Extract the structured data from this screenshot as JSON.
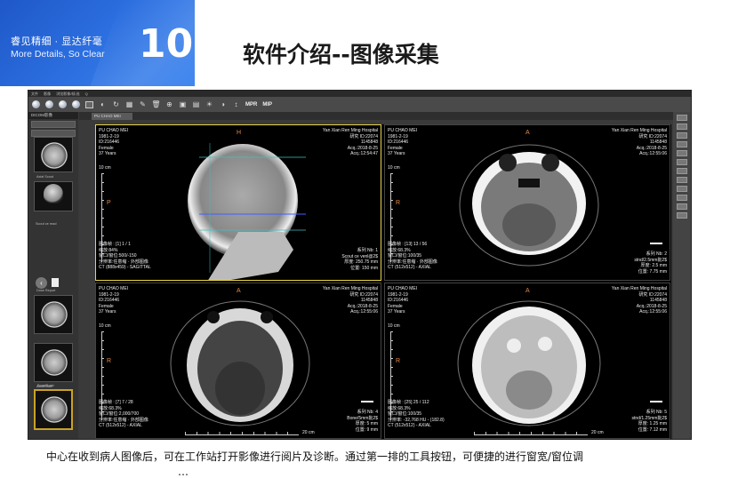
{
  "banner": {
    "slogan_cn": "睿见精细 · 显达纤毫",
    "slogan_en": "More Details, So Clear",
    "slide_number": "10"
  },
  "title": "软件介绍--图像采集",
  "app": {
    "menu": [
      "文件",
      "影像",
      "浏览影像/帧/选",
      "Q"
    ],
    "toolbar_text": [
      "MPR",
      "MIP"
    ],
    "sidebar": {
      "header": "DICOM影像",
      "series": [
        {
          "label": "Axial Scout"
        },
        {
          "label": "Scout ce read"
        },
        {
          "label": "Dose Report"
        },
        {
          "label": "Axial/Brain"
        },
        {
          "label": "Bone/Brain"
        },
        {
          "label": ""
        }
      ]
    },
    "tab": "PU CHAO MEI"
  },
  "panes": [
    {
      "patient": [
        "PU CHAO MEI",
        "1981-2-19",
        "ID:216446",
        "Female",
        "37 Years"
      ],
      "hospital": [
        "Yan Xian Ren Ming Hospital",
        "研究 ID:22074",
        "1145848",
        "Acq.:2018-8-25",
        "Acq.:12:54:47"
      ],
      "top_orient": "H",
      "left_orient": "P",
      "scale": "10 cm",
      "bottom_left": [
        "图像帧 : [1] 1 / 1",
        "缩放:84%",
        "窗口/窗位:500/-150",
        "分辨率:任意缩 · 外部图像",
        "CT (888x459) - SAGITTAL"
      ],
      "bottom_right": [
        "系列 Nb: 1",
        "Scout ce venl@2$",
        "厚度: 250.75 mm",
        "位置: 150 mm"
      ],
      "scale_label": "20 cm"
    },
    {
      "patient": [
        "PU CHAO MEI",
        "1981-2-19",
        "ID:216446",
        "Female",
        "37 Years"
      ],
      "hospital": [
        "Yan Xian Ren Ming Hospital",
        "研究 ID:22074",
        "1145848",
        "Acq.:2018-8-25",
        "Acq.:12:55:06"
      ],
      "top_orient": "A",
      "left_orient": "R",
      "scale": "10 cm",
      "bottom_left": [
        "图像帧 : [13] 13 / 56",
        "缩放:68.3%",
        "窗口/窗位:100/35",
        "分辨率:任意缩 · 外部图像",
        "CT (512x512) - AXIAL"
      ],
      "bottom_right": [
        "系列 Nb: 2",
        "stnd/2.5mm批2$",
        "厚度: 2.5 mm",
        "位置: 7.75 mm"
      ],
      "scale_label": "20 cm"
    },
    {
      "patient": [
        "PU CHAO MEI",
        "1981-2-19",
        "ID:216446",
        "Female",
        "37 Years"
      ],
      "hospital": [
        "Yan Xian Ren Ming Hospital",
        "研究 ID:22074",
        "1145848",
        "Acq.:2018-8-25",
        "Acq.:12:55:06"
      ],
      "top_orient": "A",
      "left_orient": "R",
      "scale": "10 cm",
      "bottom_left": [
        "图像帧 : [7] 7 / 28",
        "缩放:68.3%",
        "窗口/窗位:2,000/700",
        "分辨率:任意缩 · 外部图像",
        "CT (512x512) - AXIAL"
      ],
      "bottom_right": [
        "系列 Nb: 4",
        "Bone/5mm批2$",
        "厚度: 5 mm",
        "位置: 9 mm"
      ],
      "scale_label": "20 cm"
    },
    {
      "patient": [
        "PU CHAO MEI",
        "1981-2-19",
        "ID:216446",
        "Female",
        "37 Years"
      ],
      "hospital": [
        "Yan Xian Ren Ming Hospital",
        "研究 ID:22074",
        "1145848",
        "Acq.:2018-8-25",
        "Acq.:12:55:06"
      ],
      "top_orient": "A",
      "left_orient": "R",
      "scale": "10 cm",
      "bottom_left": [
        "图像帧 : [25] 25 / 112",
        "缩放:68.3%",
        "窗口/窗位:100/35",
        "分辨率: -32,768 HU - (182.8)",
        "CT (512x512) - AXIAL"
      ],
      "bottom_right": [
        "系列 Nb: 5",
        "stnd/1.25mm批2$",
        "厚度: 1.25 mm",
        "位置: 7.12 mm"
      ],
      "scale_label": "20 cm"
    }
  ],
  "caption_line1": "中心在收到病人图像后，可在工作站打开影像进行阅片及诊断。通过第一排的工具按钮，可便捷的进行窗宽/窗位调",
  "caption_line2": "…"
}
